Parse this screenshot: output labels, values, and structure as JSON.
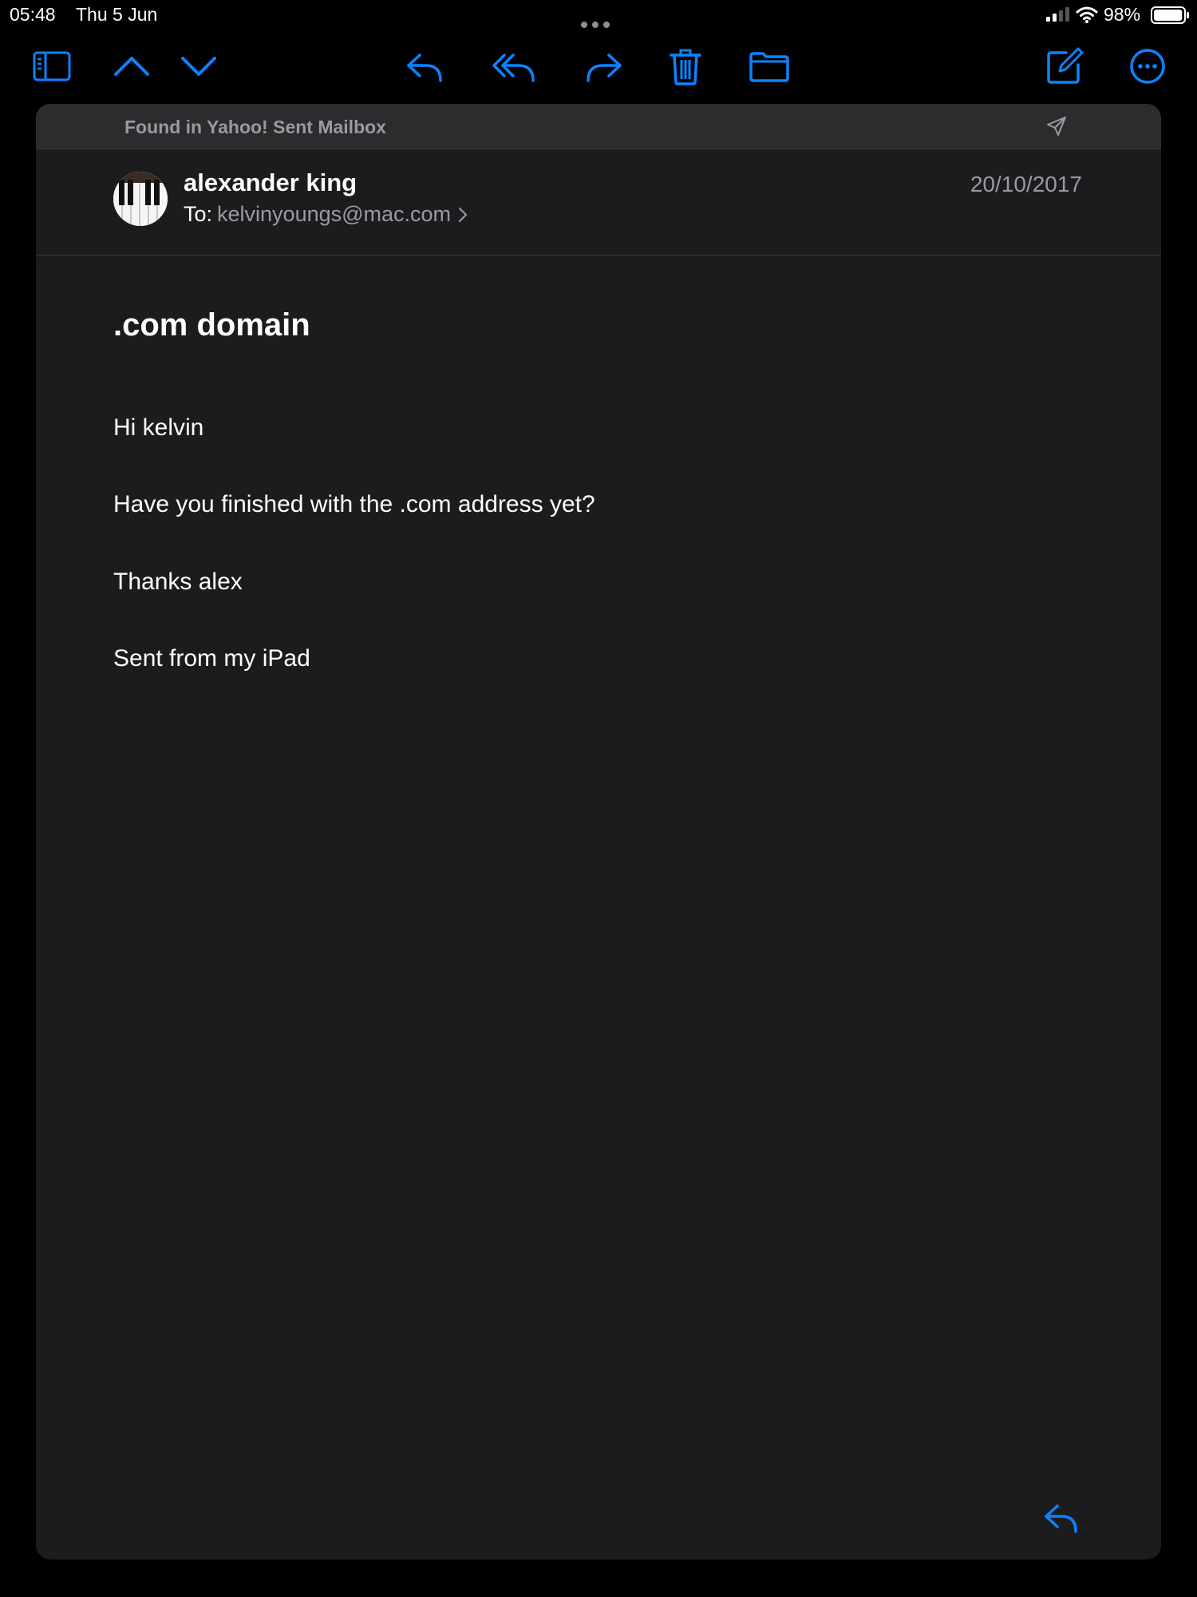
{
  "status_bar": {
    "time": "05:48",
    "date": "Thu 5 Jun",
    "battery_percent": "98%",
    "battery_level": 0.98
  },
  "toolbar": {
    "icons": [
      "sidebar-icon",
      "chevron-up-icon",
      "chevron-down-icon",
      "reply-icon",
      "reply-all-icon",
      "forward-icon",
      "trash-icon",
      "folder-icon",
      "compose-icon",
      "more-icon"
    ],
    "accent_color": "#0a84ff"
  },
  "mailbox_banner": {
    "text": "Found in Yahoo! Sent Mailbox",
    "icon": "sent-icon"
  },
  "message": {
    "sender": "alexander king",
    "to_label": "To:",
    "to_address": "kelvinyoungs@mac.com",
    "date": "20/10/2017",
    "subject": ".com domain",
    "body": [
      "Hi kelvin",
      "Have you finished with the .com address yet?",
      "Thanks alex",
      "Sent from my iPad"
    ]
  },
  "colors": {
    "background": "#000000",
    "card": "#1c1c1e",
    "banner": "#2c2c2e",
    "secondary_text": "#9a9aa0"
  }
}
